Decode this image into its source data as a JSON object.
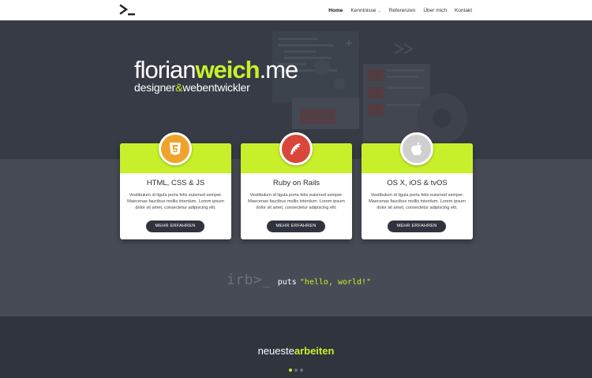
{
  "nav": {
    "items": [
      {
        "label": "Home",
        "active": true
      },
      {
        "label": "Kenntnisse",
        "dropdown": true
      },
      {
        "label": "Referenzen"
      },
      {
        "label": "Über mich"
      },
      {
        "label": "Kontakt"
      }
    ]
  },
  "hero": {
    "brand_first": "florian",
    "brand_second": "weich",
    "brand_tld": ".me",
    "tag_first": "designer",
    "tag_amp": "&",
    "tag_second": "webentwickler"
  },
  "cards": [
    {
      "title": "HTML, CSS & JS",
      "text": "Vestibulum id ligula porta felis euismod semper. Maecenas faucibus mollis interdum. Lorem ipsum dolor sit amet, consectetur adipiscing elit.",
      "button": "MEHR ERFAHREN",
      "icon": "html5-icon",
      "icon_color": "#f0a32c"
    },
    {
      "title": "Ruby on Rails",
      "text": "Vestibulum id ligula porta felis euismod semper. Maecenas faucibus mollis interdum. Lorem ipsum dolor sit amet, consectetur adipiscing elit.",
      "button": "MEHR ERFAHREN",
      "icon": "rails-icon",
      "icon_color": "#d9473b"
    },
    {
      "title": "OS X, iOS & tvOS",
      "text": "Vestibulum id ligula porta felis euismod semper. Maecenas faucibus mollis interdum. Lorem ipsum dolor sit amet, consectetur adipiscing elit.",
      "button": "MEHR ERFAHREN",
      "icon": "apple-icon",
      "icon_color": "#cfcfcf"
    }
  ],
  "irb": {
    "prompt": "irb>_",
    "command": "puts",
    "string": "\"hello, world!\""
  },
  "works": {
    "title_first": "neueste",
    "title_second": "arbeiten"
  },
  "colors": {
    "accent": "#c8f02a",
    "dark": "#30343d",
    "hero": "#363b45"
  }
}
